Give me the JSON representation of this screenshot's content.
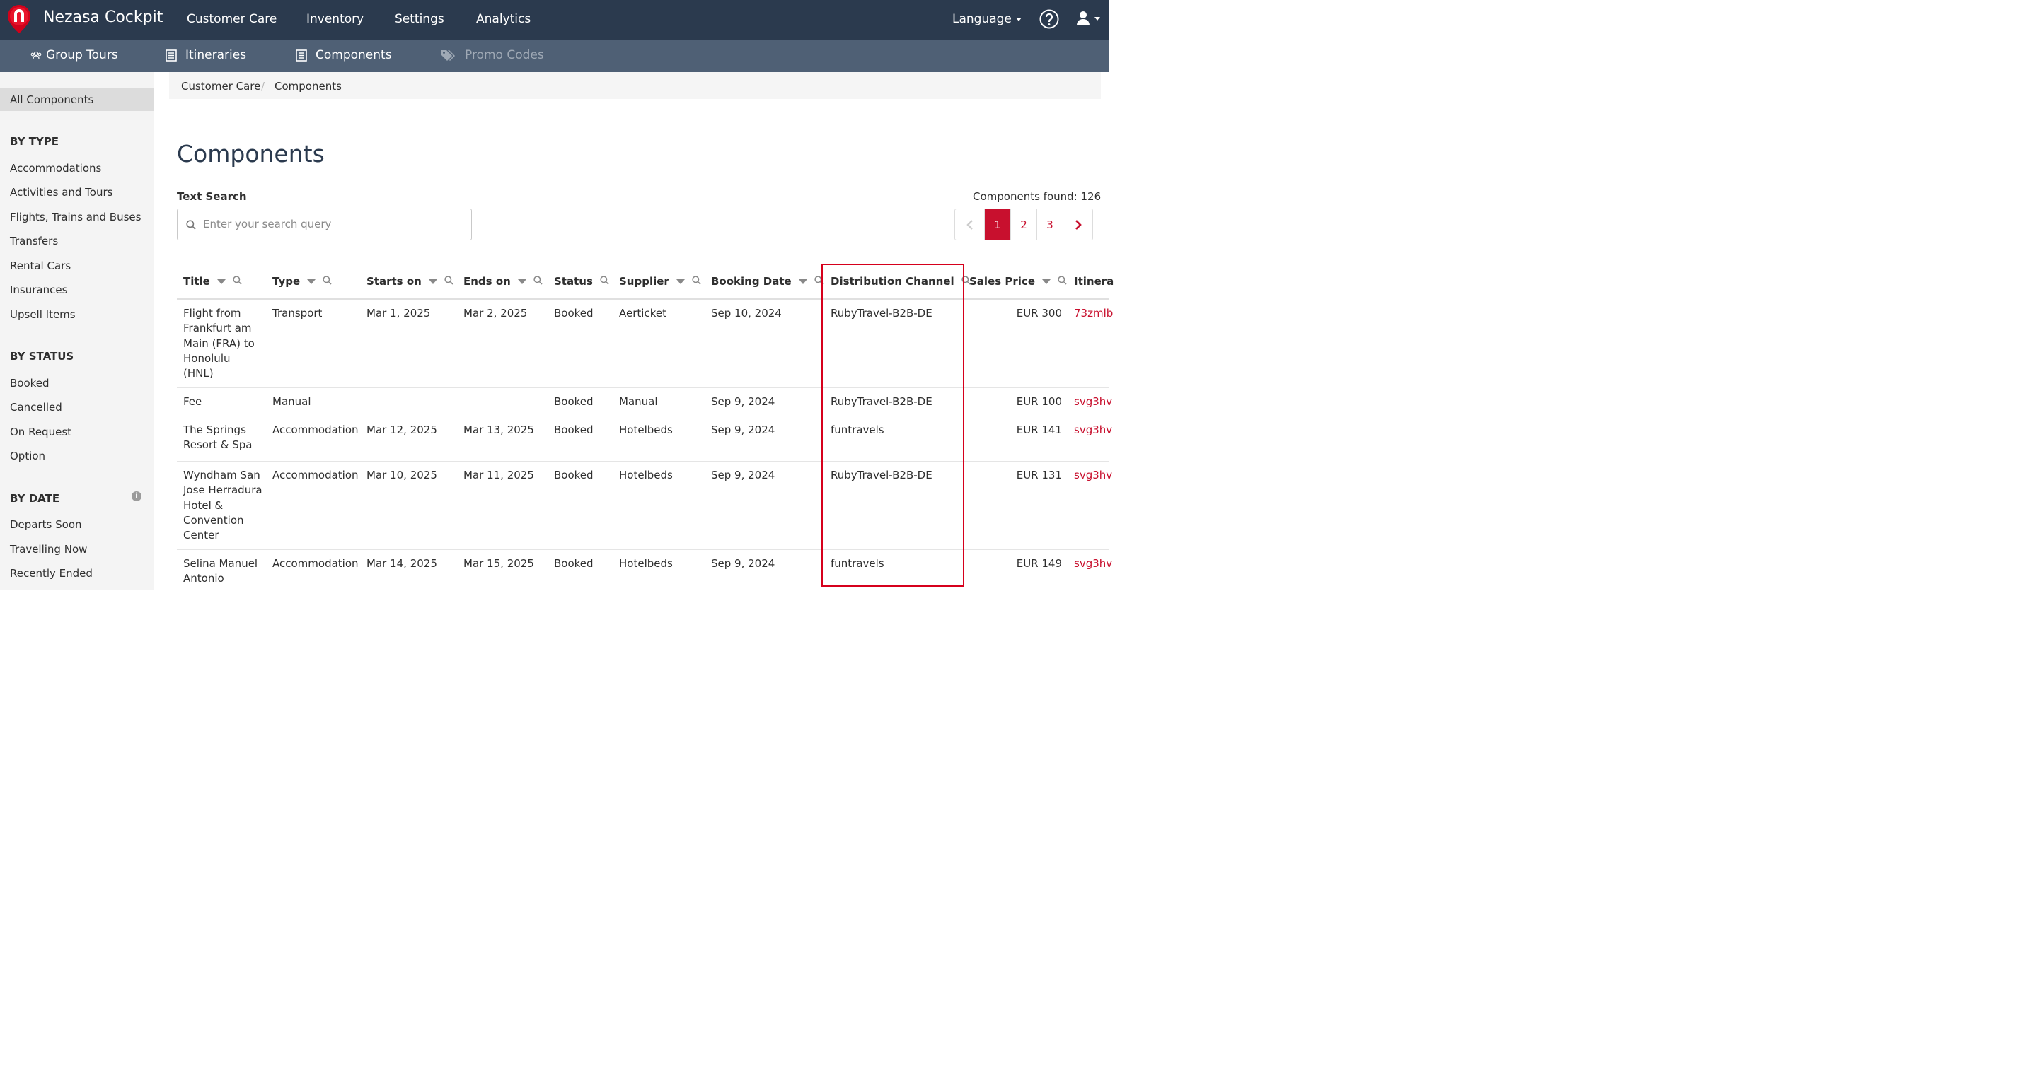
{
  "app": {
    "brand": "Nezasa Cockpit"
  },
  "topnav": [
    "Customer Care",
    "Inventory",
    "Settings",
    "Analytics"
  ],
  "language_label": "Language",
  "subnav": [
    {
      "label": "Group Tours",
      "icon": "group-icon",
      "active": false
    },
    {
      "label": "Itineraries",
      "icon": "list-icon",
      "active": false
    },
    {
      "label": "Components",
      "icon": "list-icon",
      "active": true
    },
    {
      "label": "Promo Codes",
      "icon": "tags-icon",
      "disabled": true
    }
  ],
  "sidebar": {
    "all": "All Components",
    "by_type_heading": "BY TYPE",
    "by_type": [
      "Accommodations",
      "Activities and Tours",
      "Flights, Trains and Buses",
      "Transfers",
      "Rental Cars",
      "Insurances",
      "Upsell Items"
    ],
    "by_status_heading": "BY STATUS",
    "by_status": [
      "Booked",
      "Cancelled",
      "On Request",
      "Option"
    ],
    "by_date_heading": "BY DATE",
    "by_date": [
      "Departs Soon",
      "Travelling Now",
      "Recently Ended"
    ]
  },
  "breadcrumb": [
    "Customer Care",
    "Components"
  ],
  "page_title": "Components",
  "search": {
    "label": "Text Search",
    "placeholder": "Enter your search query",
    "value": ""
  },
  "found_label": "Components found: 126",
  "pagination": {
    "pages": [
      "1",
      "2",
      "3"
    ],
    "current": "1"
  },
  "columns": [
    "Title",
    "Type",
    "Starts on",
    "Ends on",
    "Status",
    "Supplier",
    "Booking Date",
    "Distribution Channel",
    "Sales Price",
    "Itinera"
  ],
  "rows": [
    {
      "title_lines": [
        "Flight from",
        "Frankfurt am",
        "Main (FRA) to",
        "Honolulu",
        "(HNL)"
      ],
      "type": "Transport",
      "starts": "Mar 1, 2025",
      "ends": "Mar 2, 2025",
      "status": "Booked",
      "supplier": "Aerticket",
      "booking_date": "Sep 10, 2024",
      "channel": "RubyTravel-B2B-DE",
      "price": "EUR 300",
      "itinerary": "73zmlb"
    },
    {
      "title_lines": [
        "Fee"
      ],
      "type": "Manual",
      "starts": "",
      "ends": "",
      "status": "Booked",
      "supplier": "Manual",
      "booking_date": "Sep 9, 2024",
      "channel": "RubyTravel-B2B-DE",
      "price": "EUR 100",
      "itinerary": "svg3hv"
    },
    {
      "title_lines": [
        "The Springs",
        "Resort & Spa"
      ],
      "type": "Accommodation",
      "starts": "Mar 12, 2025",
      "ends": "Mar 13, 2025",
      "status": "Booked",
      "supplier": "Hotelbeds",
      "booking_date": "Sep 9, 2024",
      "channel": "funtravels",
      "price": "EUR 141",
      "itinerary": "svg3hv"
    },
    {
      "title_lines": [
        "Wyndham San",
        "Jose Herradura",
        "Hotel &",
        "Convention",
        "Center"
      ],
      "type": "Accommodation",
      "starts": "Mar 10, 2025",
      "ends": "Mar 11, 2025",
      "status": "Booked",
      "supplier": "Hotelbeds",
      "booking_date": "Sep 9, 2024",
      "channel": "RubyTravel-B2B-DE",
      "price": "EUR 131",
      "itinerary": "svg3hv"
    },
    {
      "title_lines": [
        "Selina Manuel",
        "Antonio"
      ],
      "type": "Accommodation",
      "starts": "Mar 14, 2025",
      "ends": "Mar 15, 2025",
      "status": "Booked",
      "supplier": "Hotelbeds",
      "booking_date": "Sep 9, 2024",
      "channel": "funtravels",
      "price": "EUR 149",
      "itinerary": "svg3hv"
    }
  ],
  "colors": {
    "navbar": "#2b3a4e",
    "subnav": "#4f6075",
    "accent": "#c8102e",
    "highlight": "#d6001c"
  }
}
